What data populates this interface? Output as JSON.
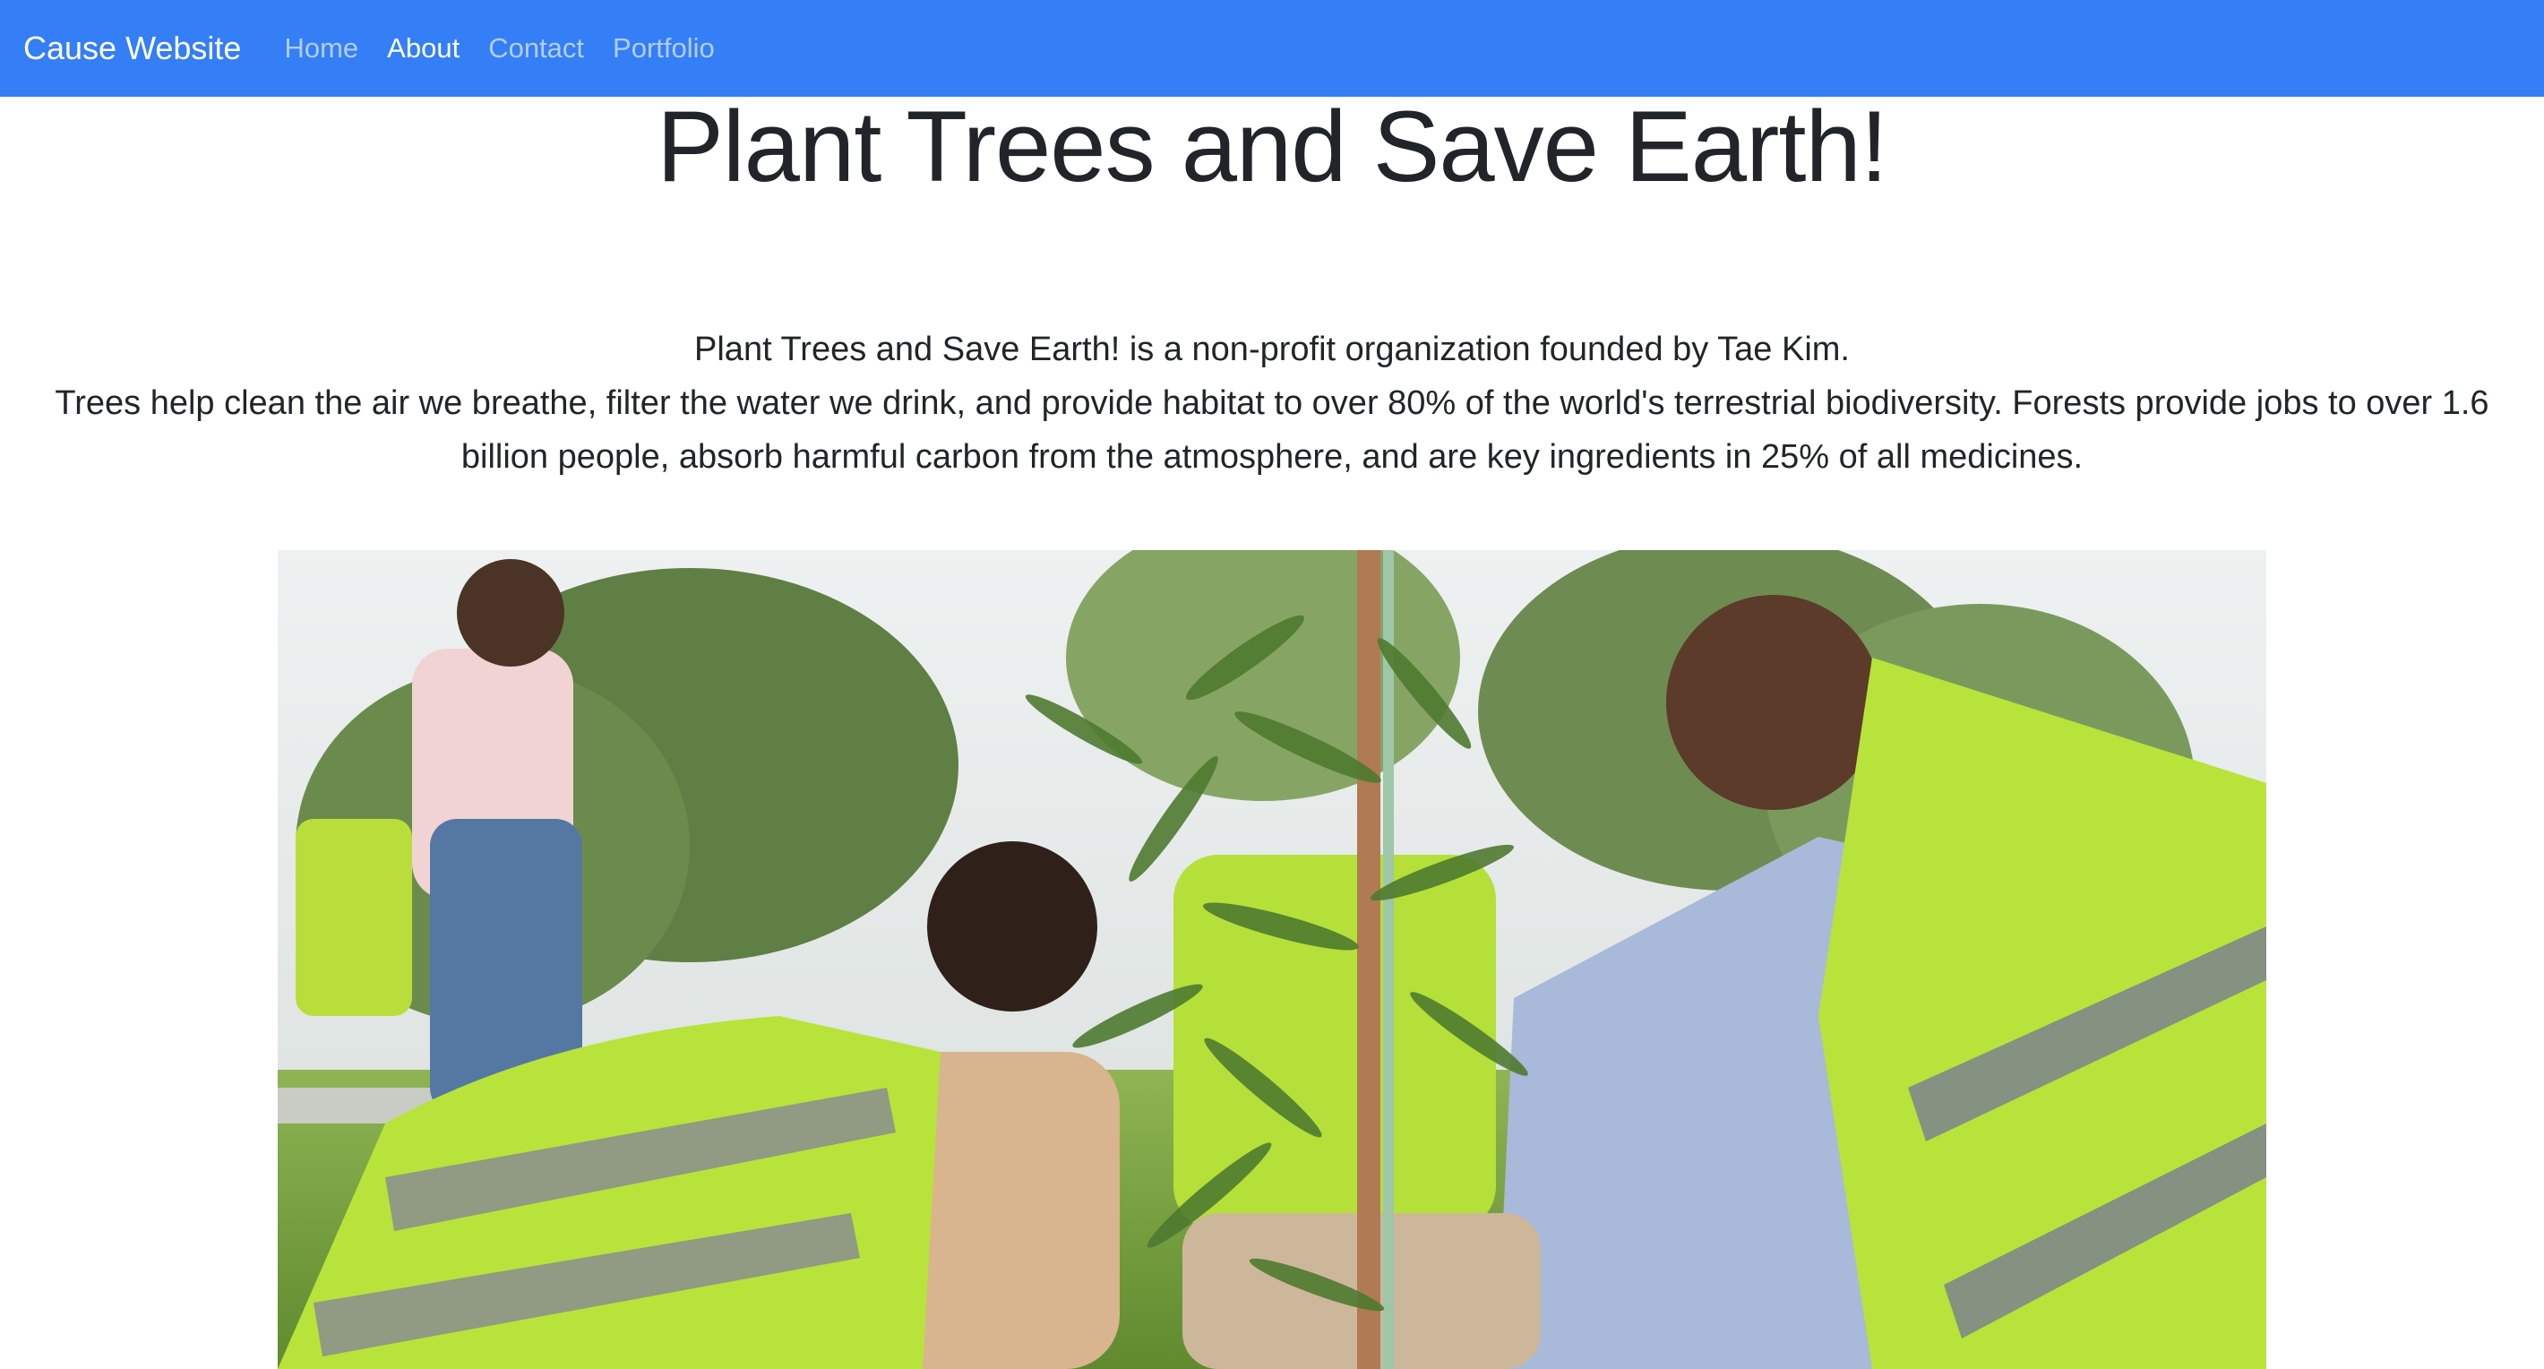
{
  "navbar": {
    "brand": "Cause Website",
    "links": [
      {
        "label": "Home",
        "active": false
      },
      {
        "label": "About",
        "active": true
      },
      {
        "label": "Contact",
        "active": false
      },
      {
        "label": "Portfolio",
        "active": false
      }
    ]
  },
  "main": {
    "title": "Plant Trees and Save Earth!",
    "intro": "Plant Trees and Save Earth! is a non-profit organization founded by Tae Kim.",
    "body": "Trees help clean the air we breathe, filter the water we drink, and provide habitat to over 80% of the world's terrestrial biodiversity. Forests provide jobs to over 1.6 billion people, absorb harmful carbon from the atmosphere, and are key ingredients in 25% of all medicines."
  },
  "colors": {
    "navbar_bg": "#347ef6",
    "vest": "#b8e33a",
    "grass": "#6f9a38"
  }
}
